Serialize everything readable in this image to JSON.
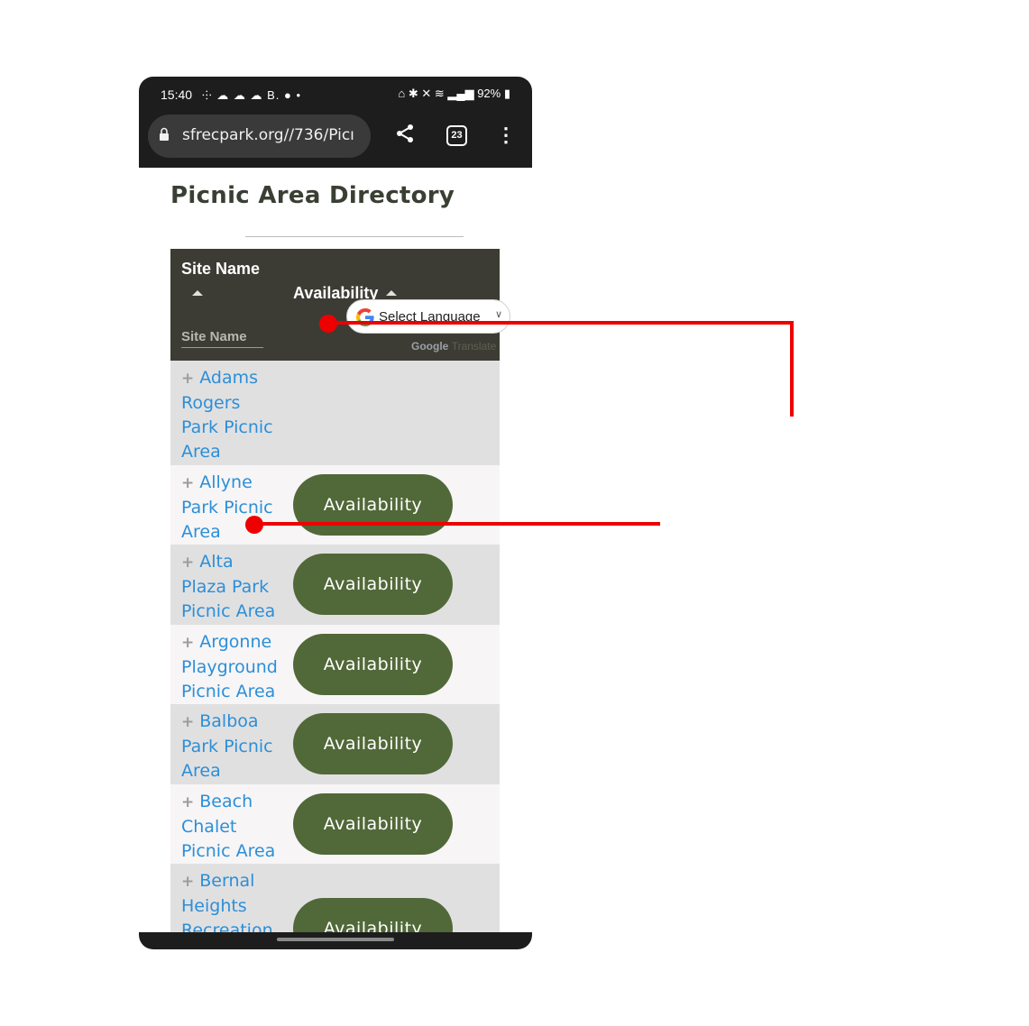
{
  "status": {
    "time": "15:40",
    "left_icons": "⸭ ☁ ☁ ☁ B. ● •",
    "battery": "92%"
  },
  "browser": {
    "url": "sfrecpark.org//736/Picı",
    "tab_count": "23"
  },
  "page": {
    "title": "Picnic Area Directory"
  },
  "table": {
    "col_site": "Site Name",
    "col_availability": "Availability",
    "filter_placeholder": "Site Name",
    "language_select": "Select Language",
    "powered_google": "Google",
    "powered_translate": "Translate",
    "rows": [
      {
        "name_lines": [
          "Adams",
          "Rogers",
          "Park Picnic",
          "Area"
        ],
        "button": ""
      },
      {
        "name_lines": [
          "Allyne",
          "Park Picnic",
          "Area"
        ],
        "button": "Availability"
      },
      {
        "name_lines": [
          "Alta",
          "Plaza Park",
          "Picnic Area"
        ],
        "button": "Availability"
      },
      {
        "name_lines": [
          "Argonne",
          "Playground",
          "Picnic Area"
        ],
        "button": "Availability"
      },
      {
        "name_lines": [
          "Balboa",
          "Park Picnic",
          "Area"
        ],
        "button": "Availability"
      },
      {
        "name_lines": [
          "Beach",
          "Chalet",
          "Picnic Area"
        ],
        "button": "Availability"
      },
      {
        "name_lines": [
          "Bernal",
          "Heights",
          "Recreation"
        ],
        "button": "Availability"
      }
    ]
  },
  "colors": {
    "header_bg": "#3c3c34",
    "button_bg": "#516838",
    "link": "#2b8fd8",
    "annotation": "#ee0000"
  }
}
